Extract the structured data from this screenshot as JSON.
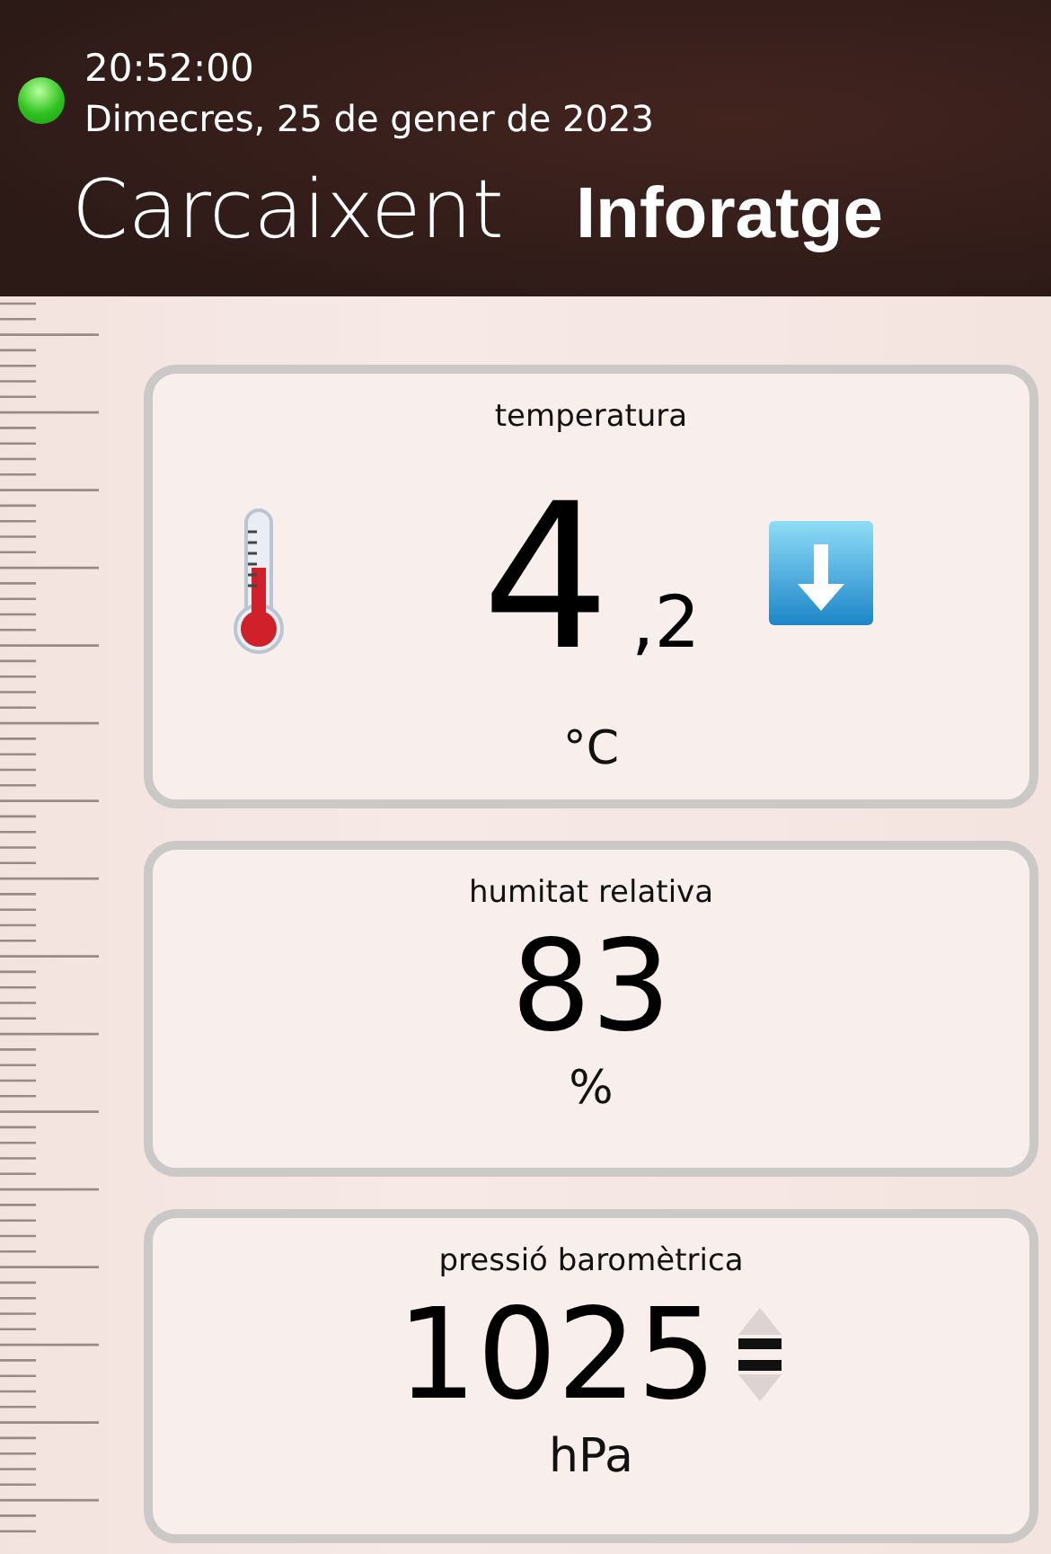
{
  "status": {
    "online": true,
    "time": "20:52:00",
    "date": "Dimecres, 25 de gener de 2023"
  },
  "brand": {
    "city": "Carcaixent",
    "name": "Inforatge"
  },
  "cards": [
    {
      "kind": "temperature",
      "label": "temperatura",
      "value": "4",
      "decimal": ",2",
      "unit": "°C",
      "trend": {
        "kind": "down"
      }
    },
    {
      "kind": "plain",
      "label": "humitat relativa",
      "value": "83",
      "unit": "%"
    },
    {
      "kind": "pressure",
      "label": "pressió baromètrica",
      "value": "1025",
      "unit": "hPa",
      "trend": {
        "kind": "steady"
      }
    }
  ]
}
